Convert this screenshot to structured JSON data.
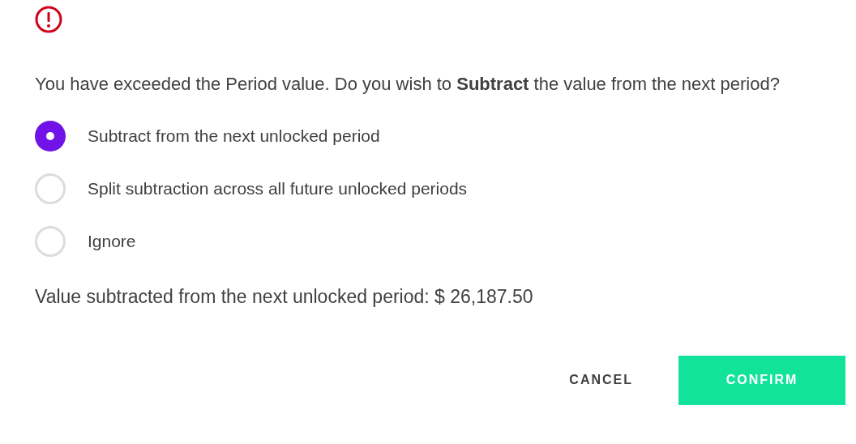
{
  "message": "You have exceeded the Period value. Do you wish to **Subtract** the value from the next period?",
  "options": [
    {
      "label": "Subtract from the next unlocked period",
      "selected": true
    },
    {
      "label": "Split subtraction across all future unlocked periods",
      "selected": false
    },
    {
      "label": "Ignore",
      "selected": false
    }
  ],
  "summary": "Value subtracted from the next unlocked period: $ 26,187.50",
  "buttons": [
    {
      "kind": "text",
      "label": "CANCEL"
    },
    {
      "kind": "primary",
      "label": "CONFIRM"
    }
  ]
}
